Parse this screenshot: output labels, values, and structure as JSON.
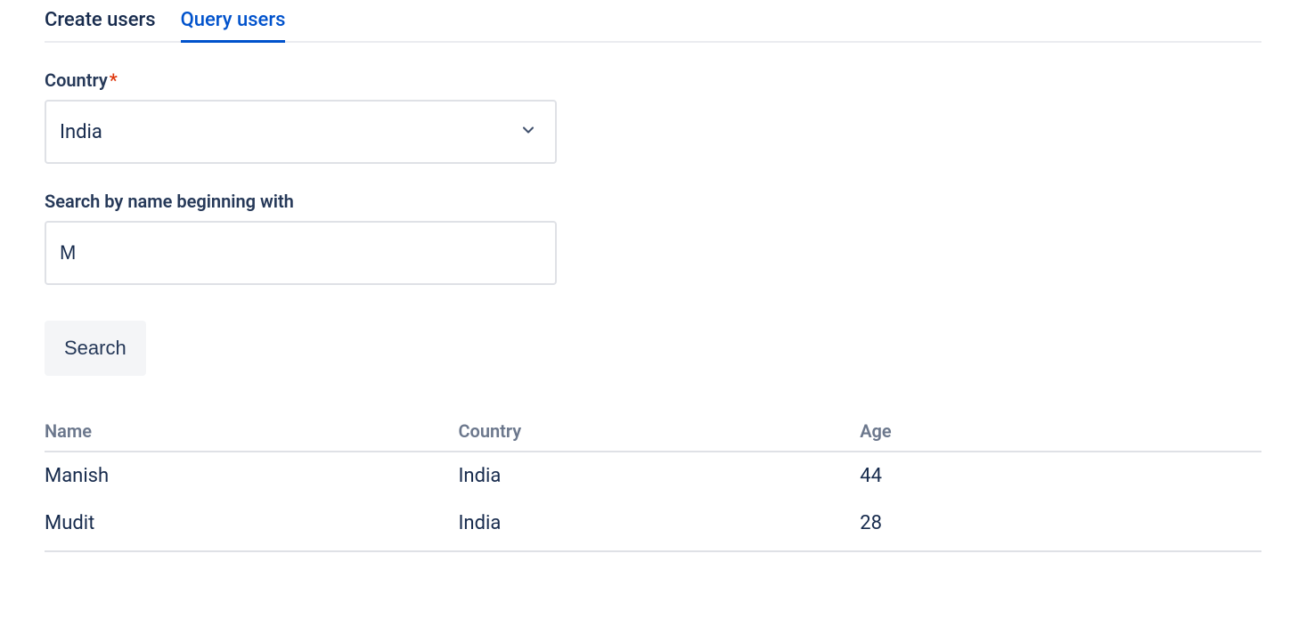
{
  "tabs": {
    "create": "Create users",
    "query": "Query users"
  },
  "form": {
    "country_label": "Country",
    "country_value": "India",
    "search_label": "Search by name beginning with",
    "search_value": "M",
    "search_button": "Search"
  },
  "table": {
    "headers": {
      "name": "Name",
      "country": "Country",
      "age": "Age"
    },
    "rows": [
      {
        "name": "Manish",
        "country": "India",
        "age": "44"
      },
      {
        "name": "Mudit",
        "country": "India",
        "age": "28"
      }
    ]
  }
}
